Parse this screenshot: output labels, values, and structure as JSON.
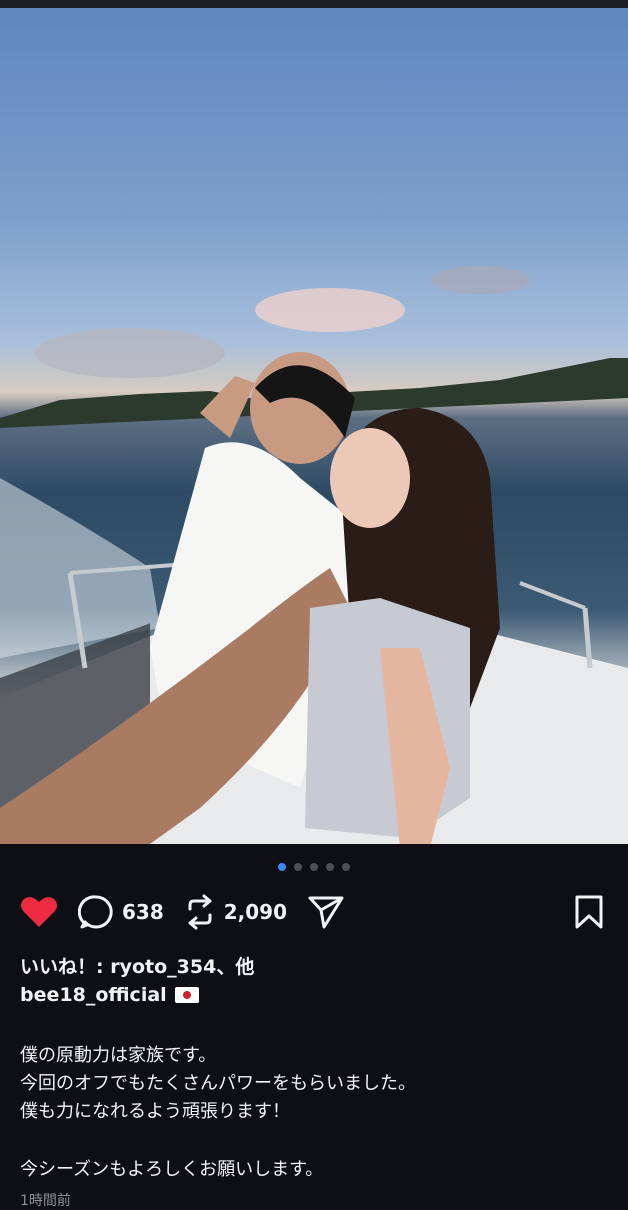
{
  "post": {
    "image_alt": "Selfie of a couple on a boat at sunset",
    "carousel": {
      "total": 5,
      "active": 1
    }
  },
  "actions": {
    "comments_count": "638",
    "reposts_count": "2,090"
  },
  "likes_text": "いいね！: ryoto_354、他",
  "username": "bee18_official",
  "caption": {
    "line1": "僕の原動力は家族です。",
    "line2": "今回のオフでもたくさんパワーをもらいました。",
    "line3": "僕も力になれるよう頑張ります！",
    "line4": "今シーズンもよろしくお願いします。"
  },
  "timestamp": "1時間前",
  "colors": {
    "background": "#0d0f14",
    "like_red": "#ee2b40",
    "active_dot": "#3f86ff"
  },
  "icons": [
    "heart-icon",
    "comment-icon",
    "repost-icon",
    "share-icon",
    "bookmark-icon",
    "japan-flag-icon"
  ]
}
